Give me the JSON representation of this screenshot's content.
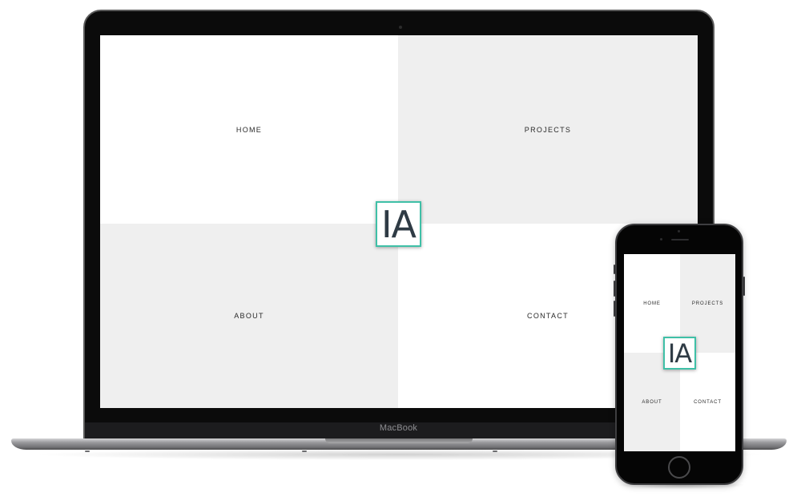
{
  "laptop": {
    "brand": "MacBook",
    "site": {
      "logo_text": "IA",
      "tiles": [
        {
          "label": "HOME",
          "bg": "white"
        },
        {
          "label": "PROJECTS",
          "bg": "grey"
        },
        {
          "label": "ABOUT",
          "bg": "grey"
        },
        {
          "label": "CONTACT",
          "bg": "white"
        }
      ]
    }
  },
  "phone": {
    "site": {
      "logo_text": "IA",
      "tiles": [
        {
          "label": "HOME",
          "bg": "white"
        },
        {
          "label": "PROJECTS",
          "bg": "grey"
        },
        {
          "label": "ABOUT",
          "bg": "grey"
        },
        {
          "label": "CONTACT",
          "bg": "white"
        }
      ]
    }
  },
  "colors": {
    "logo_border": "#3fc0a7",
    "tile_white": "#ffffff",
    "tile_grey": "#efefef",
    "text": "#2a2a2a",
    "device_frame": "#0b0b0b"
  }
}
